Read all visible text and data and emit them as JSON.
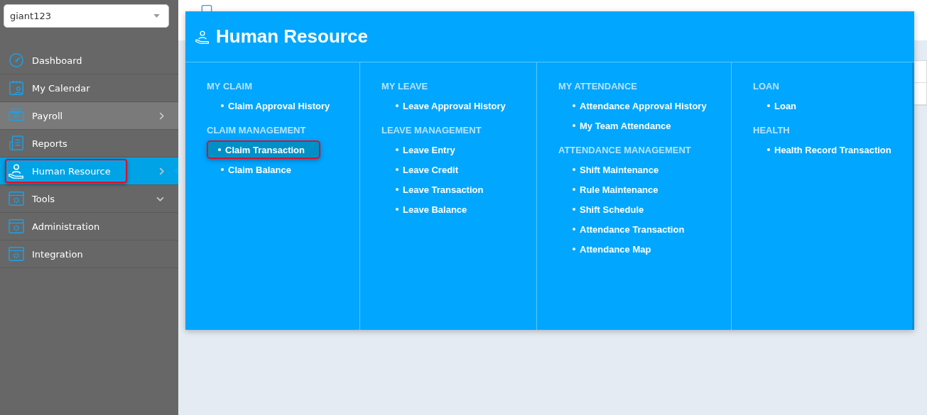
{
  "company_select": {
    "value": "giant123"
  },
  "sidebar": {
    "items": [
      {
        "label": "Dashboard",
        "selected": false,
        "hovered": false,
        "outlined": false
      },
      {
        "label": "My Calendar",
        "selected": false,
        "hovered": false,
        "outlined": false
      },
      {
        "label": "Payroll",
        "has_submenu": true,
        "expanded": false,
        "selected": false,
        "hovered": true,
        "outlined": false
      },
      {
        "label": "Reports",
        "selected": false,
        "hovered": false,
        "outlined": false
      },
      {
        "label": "Human Resource",
        "has_submenu": true,
        "expanded": false,
        "selected": true,
        "hovered": false,
        "outlined": true
      },
      {
        "label": "Tools",
        "has_submenu": true,
        "expanded": true,
        "selected": false,
        "hovered": false,
        "outlined": false
      },
      {
        "label": "Administration",
        "selected": false,
        "hovered": false,
        "outlined": false
      },
      {
        "label": "Integration",
        "selected": false,
        "hovered": false,
        "outlined": false
      }
    ]
  },
  "mega_menu": {
    "title": "Human Resource",
    "columns": [
      {
        "sections": [
          {
            "heading": "MY CLAIM",
            "links": [
              {
                "label": "Claim Approval History",
                "selected": false
              }
            ]
          },
          {
            "heading": "CLAIM MANAGEMENT",
            "links": [
              {
                "label": "Claim Transaction",
                "selected": true
              },
              {
                "label": "Claim Balance",
                "selected": false
              }
            ]
          }
        ]
      },
      {
        "sections": [
          {
            "heading": "MY LEAVE",
            "links": [
              {
                "label": "Leave Approval History",
                "selected": false
              }
            ]
          },
          {
            "heading": "LEAVE MANAGEMENT",
            "links": [
              {
                "label": "Leave Entry",
                "selected": false
              },
              {
                "label": "Leave Credit",
                "selected": false
              },
              {
                "label": "Leave Transaction",
                "selected": false
              },
              {
                "label": "Leave Balance",
                "selected": false
              }
            ]
          }
        ]
      },
      {
        "sections": [
          {
            "heading": "MY ATTENDANCE",
            "links": [
              {
                "label": "Attendance Approval History",
                "selected": false
              },
              {
                "label": "My Team Attendance",
                "selected": false
              }
            ]
          },
          {
            "heading": "ATTENDANCE MANAGEMENT",
            "links": [
              {
                "label": "Shift Maintenance",
                "selected": false
              },
              {
                "label": "Rule Maintenance",
                "selected": false
              },
              {
                "label": "Shift Schedule",
                "selected": false
              },
              {
                "label": "Attendance Transaction",
                "selected": false
              },
              {
                "label": "Attendance Map",
                "selected": false
              }
            ]
          }
        ]
      },
      {
        "sections": [
          {
            "heading": "LOAN",
            "links": [
              {
                "label": "Loan",
                "selected": false
              }
            ]
          },
          {
            "heading": "HEALTH",
            "links": [
              {
                "label": "Health Record Transaction",
                "selected": false
              }
            ]
          }
        ]
      }
    ]
  }
}
